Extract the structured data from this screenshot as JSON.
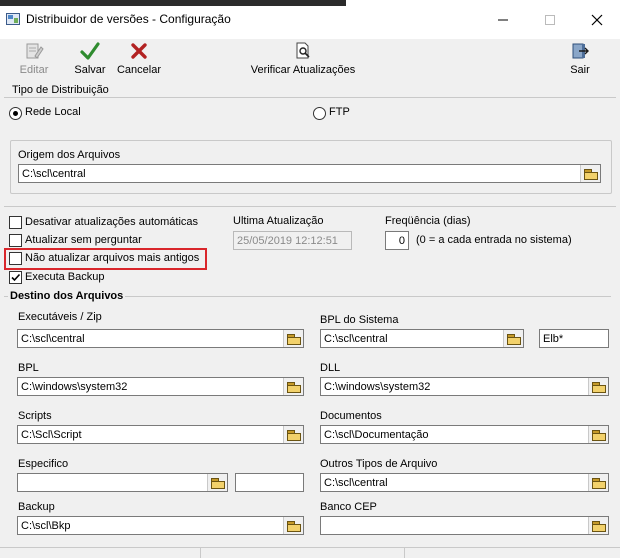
{
  "window": {
    "title": "Distribuidor de versões - Configuração",
    "controls": [
      "minimize-icon",
      "maximize-icon",
      "close-icon"
    ]
  },
  "toolbar": {
    "editar": "Editar",
    "salvar": "Salvar",
    "cancelar": "Cancelar",
    "verificar": "Verificar Atualizações",
    "sair": "Sair"
  },
  "distribuicao": {
    "title": "Tipo de Distribuição",
    "rede_local": "Rede Local",
    "ftp": "FTP",
    "selected": "Rede Local"
  },
  "origem": {
    "label": "Origem dos Arquivos",
    "value": "C:\\scl\\central"
  },
  "options": {
    "desativar": {
      "label": "Desativar atualizações automáticas",
      "checked": false
    },
    "sem_perguntar": {
      "label": "Atualizar sem perguntar",
      "checked": false
    },
    "nao_atualizar": {
      "label": "Não atualizar arquivos mais antigos",
      "checked": false
    },
    "executa_backup": {
      "label": "Executa Backup",
      "checked": true
    }
  },
  "ultima": {
    "label": "Ultima Atualização",
    "value": "25/05/2019 12:12:51"
  },
  "frequencia": {
    "label": "Freqüência (dias)",
    "value": "0",
    "hint": "(0 = a cada entrada no sistema)"
  },
  "destino": {
    "title": "Destino dos Arquivos",
    "executaveis": {
      "label": "Executáveis / Zip",
      "value": "C:\\scl\\central"
    },
    "bpl_sistema": {
      "label": "BPL do Sistema",
      "value": "C:\\scl\\central",
      "mask": "Elb*"
    },
    "bpl": {
      "label": "BPL",
      "value": "C:\\windows\\system32"
    },
    "dll": {
      "label": "DLL",
      "value": "C:\\windows\\system32"
    },
    "scripts": {
      "label": "Scripts",
      "value": "C:\\Scl\\Script"
    },
    "documentos": {
      "label": "Documentos",
      "value": "C:\\scl\\Documentação"
    },
    "especifico": {
      "label": "Especifico",
      "value": "",
      "extra": ""
    },
    "outros": {
      "label": "Outros Tipos de Arquivo",
      "value": "C:\\scl\\central"
    },
    "backup": {
      "label": "Backup",
      "value": "C:\\scl\\Bkp"
    },
    "banco_cep": {
      "label": "Banco CEP",
      "value": ""
    }
  },
  "colors": {
    "highlight": "#d9262b",
    "save_check": "#2e8b2e",
    "cancel_x": "#b22222"
  }
}
